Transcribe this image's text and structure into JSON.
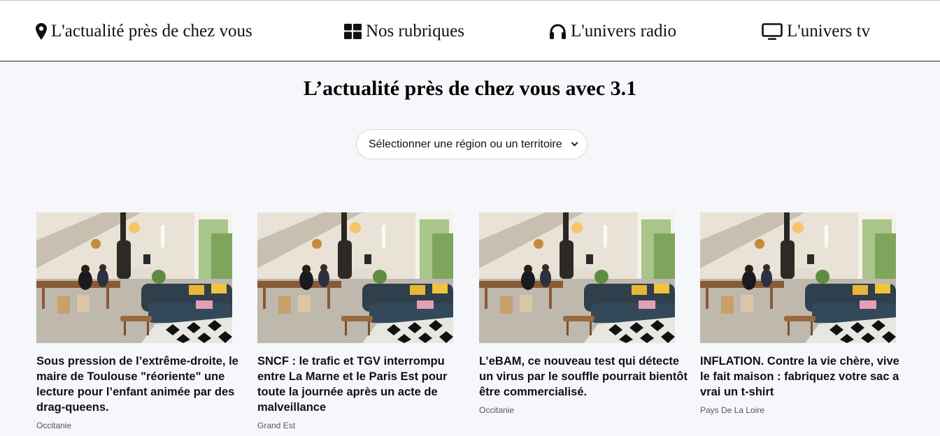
{
  "nav": {
    "items": [
      {
        "label": "L'actualité près de chez vous",
        "icon": "map-marker-icon"
      },
      {
        "label": "Nos rubriques",
        "icon": "grid-icon"
      },
      {
        "label": "L'univers radio",
        "icon": "headphones-icon"
      },
      {
        "label": "L'univers tv",
        "icon": "monitor-icon"
      }
    ]
  },
  "main": {
    "title": "L’actualité près de chez vous avec 3.1",
    "region_select": {
      "value": "Sélectionner une région ou un territoire"
    }
  },
  "articles": [
    {
      "title": "Sous pression de l’extrême-droite, le maire de Toulouse \"réoriente\" une lecture pour l’enfant animée par des drag-queens.",
      "region": "Occitanie"
    },
    {
      "title": "SNCF : le trafic et TGV interrompu entre La Marne et le Paris Est pour toute la journée après un acte de malveillance",
      "region": "Grand Est"
    },
    {
      "title": "L’eBAM, ce nouveau test qui détecte un virus par le souffle pourrait bientôt être commercialisé.",
      "region": "Occitanie"
    },
    {
      "title": "INFLATION. Contre la vie chère, vive le fait maison : fabriquez votre sac a vrai un t-shirt",
      "region": "Pays De La Loire"
    }
  ],
  "colors": {
    "page_bg": "#f5f7fb",
    "nav_bg": "#ffffff"
  }
}
